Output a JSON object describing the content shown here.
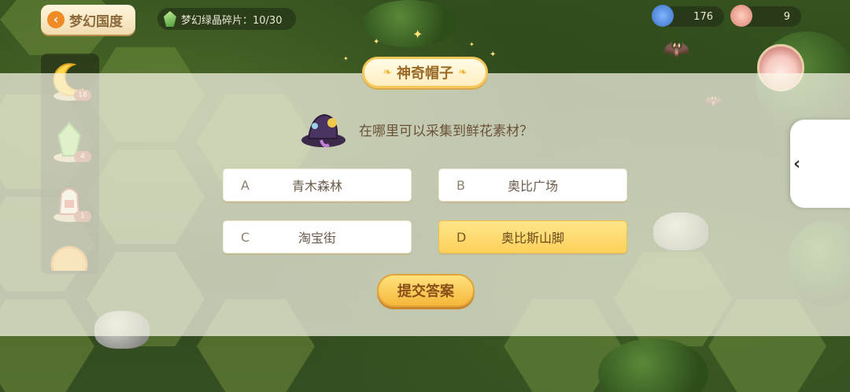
{
  "header": {
    "back_label": "梦幻国度",
    "shard_text": "梦幻绿晶碎片：10/30",
    "counter_a": "176",
    "counter_b": "9"
  },
  "inventory": [
    {
      "name": "moon",
      "badge": "18"
    },
    {
      "name": "crystal",
      "badge": "4"
    },
    {
      "name": "lantern",
      "badge": "1"
    },
    {
      "name": "coin",
      "badge": ""
    }
  ],
  "quiz": {
    "title": "神奇帽子",
    "question": "在哪里可以采集到鲜花素材？",
    "options": [
      {
        "letter": "A",
        "text": "青木森林",
        "selected": false
      },
      {
        "letter": "B",
        "text": "奥比广场",
        "selected": false
      },
      {
        "letter": "C",
        "text": "淘宝街",
        "selected": false
      },
      {
        "letter": "D",
        "text": "奥比斯山脚",
        "selected": true
      }
    ],
    "submit_label": "提交答案"
  },
  "colors": {
    "selected_option": "#fdd15b",
    "submit_button": "#f5b73c",
    "title_border": "#f5c85c"
  }
}
